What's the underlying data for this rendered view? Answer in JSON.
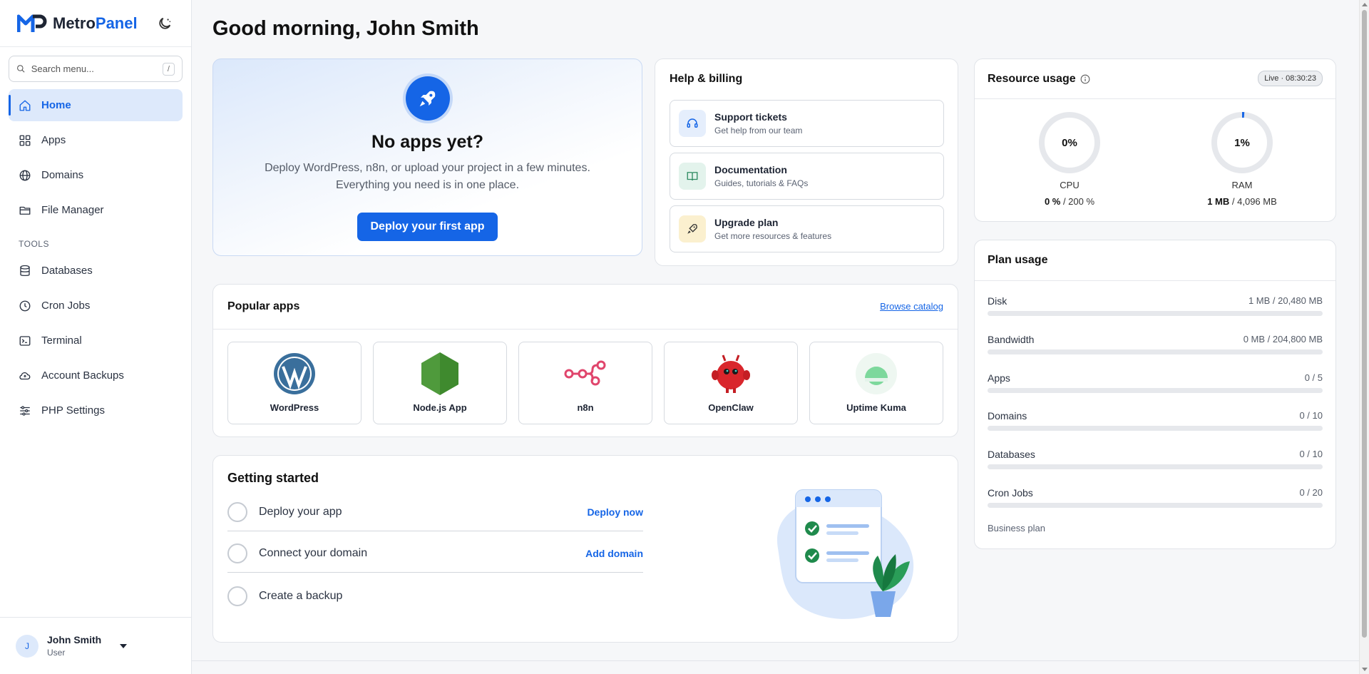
{
  "sidebar": {
    "brand": {
      "name_part1": "Metro",
      "name_part2": "Panel"
    },
    "search": {
      "placeholder": "Search menu...",
      "shortcut": "/"
    },
    "nav": [
      {
        "label": "Home",
        "icon": "home-icon",
        "active": true
      },
      {
        "label": "Apps",
        "icon": "grid-icon"
      },
      {
        "label": "Domains",
        "icon": "globe-icon"
      },
      {
        "label": "File Manager",
        "icon": "folder-icon"
      }
    ],
    "tools_label": "TOOLS",
    "tools": [
      {
        "label": "Databases",
        "icon": "database-icon"
      },
      {
        "label": "Cron Jobs",
        "icon": "clock-icon"
      },
      {
        "label": "Terminal",
        "icon": "terminal-icon"
      },
      {
        "label": "Account Backups",
        "icon": "cloud-backup-icon"
      },
      {
        "label": "PHP Settings",
        "icon": "sliders-icon"
      }
    ],
    "user": {
      "initial": "J",
      "name": "John Smith",
      "role": "User"
    }
  },
  "main": {
    "greeting": "Good morning, John Smith",
    "hero": {
      "title": "No apps yet?",
      "line1": "Deploy WordPress, n8n, or upload your project in a few minutes.",
      "line2": "Everything you need is in one place.",
      "button": "Deploy your first app"
    },
    "help": {
      "title": "Help & billing",
      "items": [
        {
          "title": "Support tickets",
          "subtitle": "Get help from our team",
          "icon": "headset-icon"
        },
        {
          "title": "Documentation",
          "subtitle": "Guides, tutorials & FAQs",
          "icon": "book-icon"
        },
        {
          "title": "Upgrade plan",
          "subtitle": "Get more resources & features",
          "icon": "rocket-icon"
        }
      ]
    },
    "resources": {
      "title": "Resource usage",
      "live": "Live · 08:30:23",
      "cpu": {
        "percent_label": "0%",
        "label": "CPU",
        "used": "0 %",
        "total": " / 200 %",
        "fraction": 0
      },
      "ram": {
        "percent_label": "1%",
        "label": "RAM",
        "used": "1 MB",
        "total": " / 4,096 MB",
        "fraction": 0.01
      }
    },
    "plan": {
      "title": "Plan usage",
      "rows": [
        {
          "label": "Disk",
          "value": "1 MB / 20,480 MB",
          "fraction": 0.0
        },
        {
          "label": "Bandwidth",
          "value": "0 MB / 204,800 MB",
          "fraction": 0
        },
        {
          "label": "Apps",
          "value": "0 / 5",
          "fraction": 0
        },
        {
          "label": "Domains",
          "value": "0 / 10",
          "fraction": 0
        },
        {
          "label": "Databases",
          "value": "0 / 10",
          "fraction": 0
        },
        {
          "label": "Cron Jobs",
          "value": "0 / 20",
          "fraction": 0
        }
      ],
      "plan_name": "Business plan"
    },
    "popular": {
      "title": "Popular apps",
      "browse": "Browse catalog",
      "apps": [
        {
          "name": "WordPress",
          "icon": "wordpress-icon"
        },
        {
          "name": "Node.js App",
          "icon": "nodejs-icon"
        },
        {
          "name": "n8n",
          "icon": "n8n-icon"
        },
        {
          "name": "OpenClaw",
          "icon": "openclaw-icon"
        },
        {
          "name": "Uptime Kuma",
          "icon": "uptime-kuma-icon"
        }
      ]
    },
    "started": {
      "title": "Getting started",
      "steps": [
        {
          "label": "Deploy your app",
          "action": "Deploy now"
        },
        {
          "label": "Connect your domain",
          "action": "Add domain"
        },
        {
          "label": "Create a backup",
          "action": ""
        }
      ]
    }
  },
  "colors": {
    "accent": "#1565e6",
    "accent_light": "#dde9fb",
    "text": "#1d2433"
  }
}
